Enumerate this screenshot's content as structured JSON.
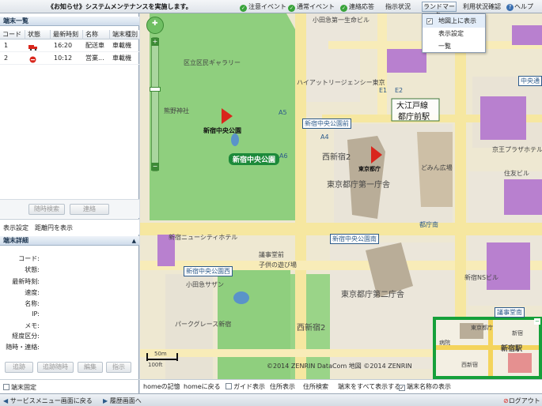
{
  "topbar": {
    "notice": "《お知らせ》システムメンテナンスを実施します。",
    "caution_event": "注意イベント",
    "normal_event": "通常イベント",
    "contact_response": "連絡応答",
    "instruction_status": "指示状況",
    "landmark": "ランドマーク▾",
    "usage_check": "利用状況確認",
    "help": "ヘルプ"
  },
  "landmark_menu": {
    "show_on_map": "地図上に表示",
    "display_settings": "表示設定",
    "list": "一覧",
    "show_on_map_checked": true
  },
  "terminal_list": {
    "title": "端末一覧",
    "columns": [
      "コード",
      "状態",
      "最新時刻",
      "名称",
      "端末種別"
    ],
    "rows": [
      {
        "code": "1",
        "status_icon": "truck-icon",
        "status_color": "#d9261c",
        "time": "16:20",
        "name": "配送車",
        "type": "車載機"
      },
      {
        "code": "2",
        "status_icon": "stop-icon",
        "status_color": "#d9261c",
        "time": "10:12",
        "name": "営業...",
        "type": "車載機"
      }
    ],
    "btn_anytime_search": "随時検索",
    "btn_contact": "連絡"
  },
  "display_settings": {
    "label": "表示設定",
    "distance_circle": "距離円を表示"
  },
  "terminal_detail": {
    "title": "端末詳細",
    "fields": [
      "コード:",
      "状態:",
      "最新時刻:",
      "速度:",
      "名称:",
      "IP:",
      "メモ:",
      "経度区分:",
      "随時・連絡:"
    ],
    "btn_trail": "追跡",
    "btn_track_anytime": "追跡随時",
    "btn_edit": "編集",
    "btn_instruction": "指示",
    "fix_terminal": "端末固定"
  },
  "map": {
    "labels": {
      "park": "新宿中央公園",
      "park_marker": "新宿中央公園",
      "tocho_marker": "東京都庁",
      "tocho_bldg1": "東京都庁第一庁舎",
      "tocho_bldg2": "東京都庁第二庁舎",
      "nishi_shinjuku2_a": "西新宿2",
      "nishi_shinjuku2_b": "西新宿2",
      "toei_oedo": "大江戸線",
      "tochomae_station": "都庁前駅",
      "park_front": "新宿中央公園前",
      "park_south": "新宿中央公園南",
      "park_west": "新宿中央公園西",
      "gallery": "区立区民ギャラリー",
      "kumano": "熊野神社",
      "hyatt": "ハイアットリージェンシー東京",
      "keio_plaza": "京王プラザホテル",
      "sumitomo": "住友ビル",
      "ns_building": "新宿NSビル",
      "gikaido": "議事堂南",
      "chuo_dori": "中央通",
      "ogaido": "小田急第一生命ビル",
      "hotel_newcity": "新宿ニューシティホテル",
      "kodomo": "子供の遊び場",
      "park_tower": "パークグレース新宿",
      "high_school": "小田急サザン",
      "tocho_minami": "都庁南",
      "tocho_inner": "どみん広場",
      "e1": "E1",
      "e2": "E2",
      "a5": "A5",
      "a4": "A4",
      "a6": "A6",
      "gikaido_tunnel": "議事堂前",
      "copyright": "©2014 ZENRIN DataCom 地図 ©2014 ZENRIN",
      "scale_m": "50m",
      "scale_ft": "100ft",
      "minimap_tocho": "東京都庁",
      "minimap_shinjuku": "新宿駅",
      "minimap_hospital": "病院",
      "minimap_shinjuku_label": "新宿",
      "minimap_area": "西新宿"
    }
  },
  "map_bottom": {
    "home_store": "homeの記憶",
    "home_return": "homeに戻る",
    "guide_show": "ガイド表示",
    "address_show": "住所表示",
    "address_search": "住所検索",
    "show_all_terminals": "端末をすべて表示する",
    "show_terminal_names": "端末名称の表示",
    "show_terminal_names_checked": true
  },
  "statusbar": {
    "back_service_menu": "サービスメニュー画面に戻る",
    "history": "履歴画面へ",
    "logout": "ログアウト"
  },
  "colors": {
    "park_green": "#8fcf7e",
    "road_yellow": "#f6e7a0",
    "building_purple": "#b880cf",
    "accent_blue": "#1a4a8a"
  }
}
